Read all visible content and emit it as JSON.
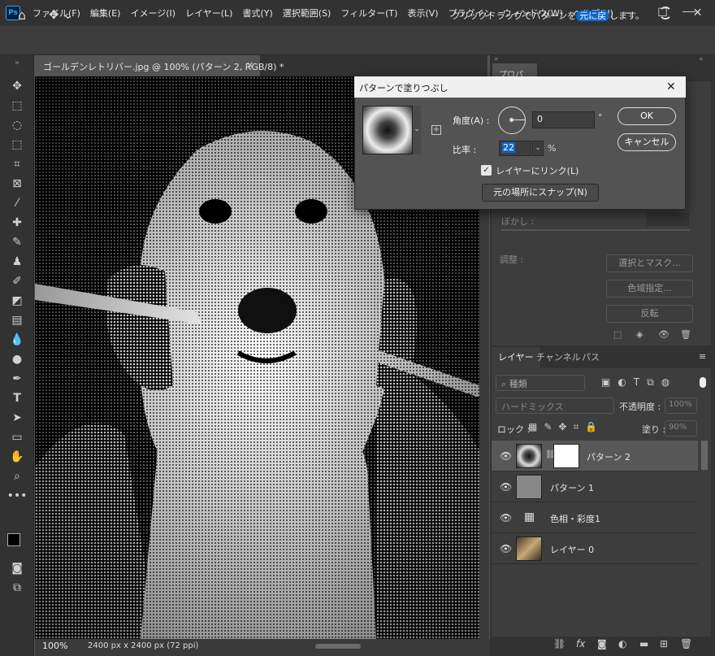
{
  "app": {
    "logo_text": "Ps"
  },
  "menu": [
    "ファイル(F)",
    "編集(E)",
    "イメージ(I)",
    "レイヤー(L)",
    "書式(Y)",
    "選択範囲(S)",
    "フィルター(T)",
    "表示(V)",
    "プラグイン",
    "ウィンドウ(W)",
    "ヘルプ(H)"
  ],
  "options_bar": {
    "hint_before": "クリックドラッグでパターンを",
    "hint_highlight": "元に戻",
    "hint_after": "します。"
  },
  "document": {
    "tab_title": "ゴールデンレトリバー.jpg @ 100% (パターン 2, RGB/8) *",
    "zoom": "100%",
    "size_info": "2400 px x 2400 px (72 ppi)"
  },
  "properties": {
    "tab_label": "プロパティ",
    "blur_label": "ぼかし :",
    "adjust_label": "調整 :",
    "buttons": [
      "選択とマスク...",
      "色域指定...",
      "反転"
    ]
  },
  "layers_panel": {
    "tabs": [
      "レイヤー",
      "チャンネル",
      "パス"
    ],
    "search_placeholder": "種類",
    "blend_mode": "ハードミックス",
    "opacity_label": "不透明度 :",
    "opacity_value": "100%",
    "lock_label": "ロック :",
    "fill_label": "塗り :",
    "fill_value": "90%",
    "layers": [
      {
        "name": "パターン 2",
        "selected": true
      },
      {
        "name": "パターン 1",
        "selected": false
      },
      {
        "name": "色相・彩度1",
        "selected": false
      },
      {
        "name": "レイヤー 0",
        "selected": false
      }
    ]
  },
  "dialog": {
    "title": "パターンで塗りつぶし",
    "angle_label": "角度(A) :",
    "angle_value": "0",
    "angle_unit": "°",
    "scale_label": "比率 :",
    "scale_value": "22",
    "scale_unit": "%",
    "link_label": "レイヤーにリンク(L)",
    "link_checked": true,
    "snap_button": "元の場所にスナップ(N)",
    "ok_button": "OK",
    "cancel_button": "キャンセル"
  }
}
